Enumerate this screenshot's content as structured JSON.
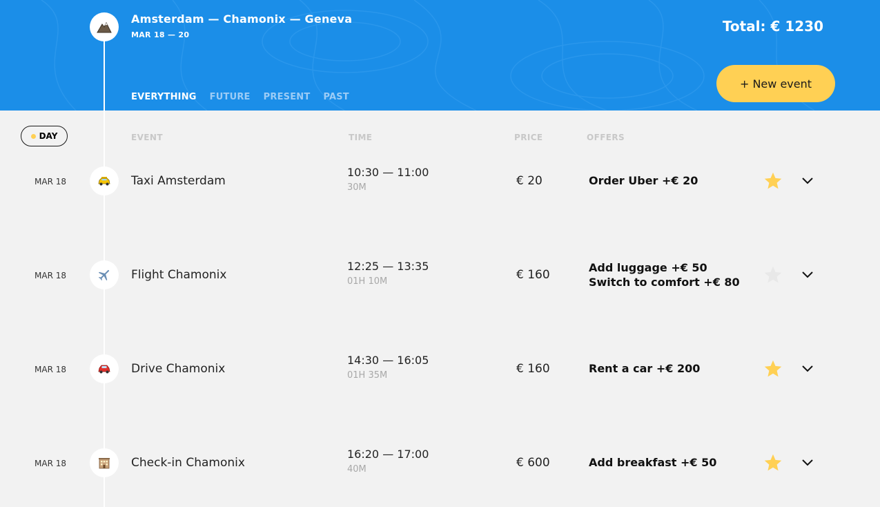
{
  "trip": {
    "title": "Amsterdam — Chamonix — Geneva",
    "dates": "MAR 18 — 20",
    "total": "Total: € 1230",
    "logo_icon": "mountain-icon"
  },
  "filters": [
    "EVERYTHING",
    "FUTURE",
    "PRESENT",
    "PAST"
  ],
  "active_filter": "EVERYTHING",
  "new_event_label": "+ New event",
  "sort": {
    "day_label": "DAY"
  },
  "columns": {
    "event": "EVENT",
    "time": "TIME",
    "price": "PRICE",
    "offers": "OFFERS"
  },
  "colors": {
    "header_bg": "#1b8ee8",
    "accent": "#ffd054",
    "background": "#f2f2f2"
  },
  "events": [
    {
      "date": "MAR 18",
      "icon": "taxi-icon",
      "name": "Taxi Amsterdam",
      "time": "10:30 — 11:00",
      "duration": "30M",
      "price": "€ 20",
      "offers": [
        "Order Uber +€  20"
      ],
      "favorite": true
    },
    {
      "date": "MAR 18",
      "icon": "airplane-icon",
      "name": "Flight Chamonix",
      "time": "12:25 — 13:35",
      "duration": "01H 10M",
      "price": "€ 160",
      "offers": [
        "Add luggage +€  50",
        "Switch to comfort +€  80"
      ],
      "favorite": false
    },
    {
      "date": "MAR 18",
      "icon": "car-icon",
      "name": "Drive Chamonix",
      "time": "14:30 — 16:05",
      "duration": "01H 35M",
      "price": "€ 160",
      "offers": [
        "Rent a car +€  200"
      ],
      "favorite": true
    },
    {
      "date": "MAR 18",
      "icon": "hotel-icon",
      "name": "Check-in Chamonix",
      "time": "16:20 — 17:00",
      "duration": "40M",
      "price": "€ 600",
      "offers": [
        "Add breakfast +€  50"
      ],
      "favorite": true
    }
  ]
}
